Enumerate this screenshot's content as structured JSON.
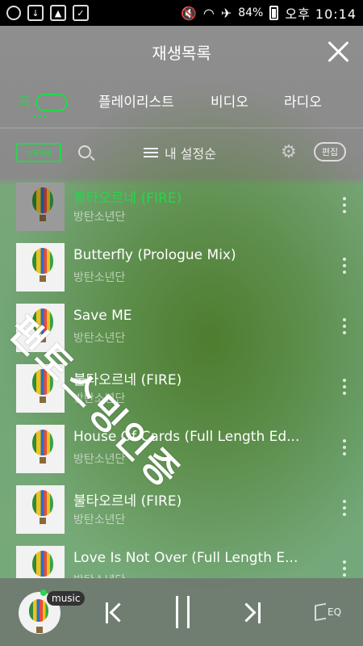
{
  "status_bar": {
    "battery": "84%",
    "time": "오후 10:14"
  },
  "header": {
    "title": "재생목록"
  },
  "tabs": [
    {
      "label": "곡",
      "active": true
    },
    {
      "label": "플레이리스트",
      "active": false
    },
    {
      "label": "비디오",
      "active": false
    },
    {
      "label": "라디오",
      "active": false
    }
  ],
  "toolbar": {
    "repeat_label": "반복재생",
    "sort_label": "내 설정순",
    "edit_label": "편집"
  },
  "songs": [
    {
      "title": "불타오르네 (FIRE)",
      "artist": "방탄소년단",
      "playing": true
    },
    {
      "title": "Butterfly (Prologue Mix)",
      "artist": "방탄소년단",
      "playing": false
    },
    {
      "title": "Save ME",
      "artist": "방탄소년단",
      "playing": false
    },
    {
      "title": "불타오르네 (FIRE)",
      "artist": "방탄소년단",
      "playing": false
    },
    {
      "title": "House Of Cards (Full Length Ed...",
      "artist": "방탄소년단",
      "playing": false
    },
    {
      "title": "불타오르네 (FIRE)",
      "artist": "방탄소년단",
      "playing": false
    },
    {
      "title": "Love Is Not Over (Full Length E...",
      "artist": "방탄소년단",
      "playing": false
    }
  ],
  "watermark": "팬토스밍인증",
  "player": {
    "badge": "music",
    "eq_label": "EQ"
  },
  "colors": {
    "accent": "#22d94a"
  }
}
